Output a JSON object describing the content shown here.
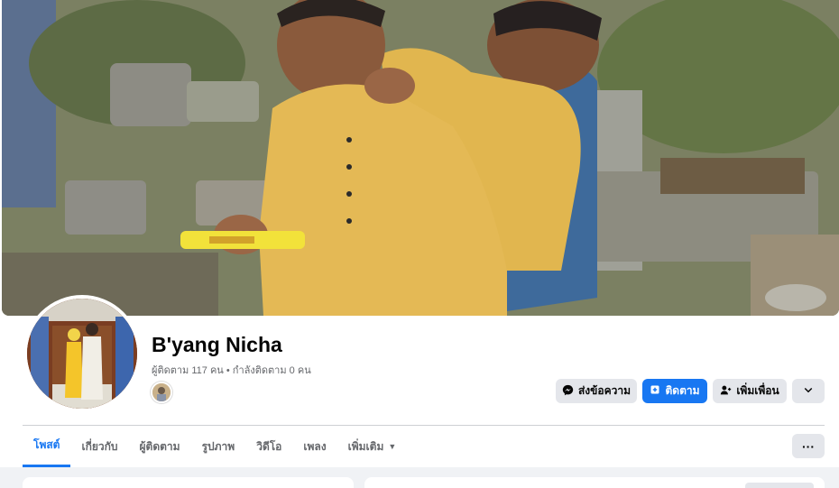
{
  "profile": {
    "name": "B'yang Nicha",
    "followers_text": "ผู้ติดตาม 117 คน • กำลังติดตาม 0 คน"
  },
  "actions": {
    "message_label": "ส่งข้อความ",
    "follow_label": "ติดตาม",
    "add_friend_label": "เพิ่มเพื่อน"
  },
  "tabs": [
    {
      "label": "โพสต์",
      "active": true
    },
    {
      "label": "เกี่ยวกับ",
      "active": false
    },
    {
      "label": "ผู้ติดตาม",
      "active": false
    },
    {
      "label": "รูปภาพ",
      "active": false
    },
    {
      "label": "วิดีโอ",
      "active": false
    },
    {
      "label": "เพลง",
      "active": false
    },
    {
      "label": "เพิ่มเติม",
      "active": false
    }
  ],
  "more_dots": "···",
  "icons": {
    "message": "messenger-icon",
    "follow": "follow-icon",
    "add_friend": "add-friend-icon",
    "more": "chevron-down-icon",
    "tab_more": "caret-down-icon"
  },
  "colors": {
    "accent": "#1877f2",
    "button_gray": "#e4e6eb",
    "muted_text": "#65676b"
  }
}
